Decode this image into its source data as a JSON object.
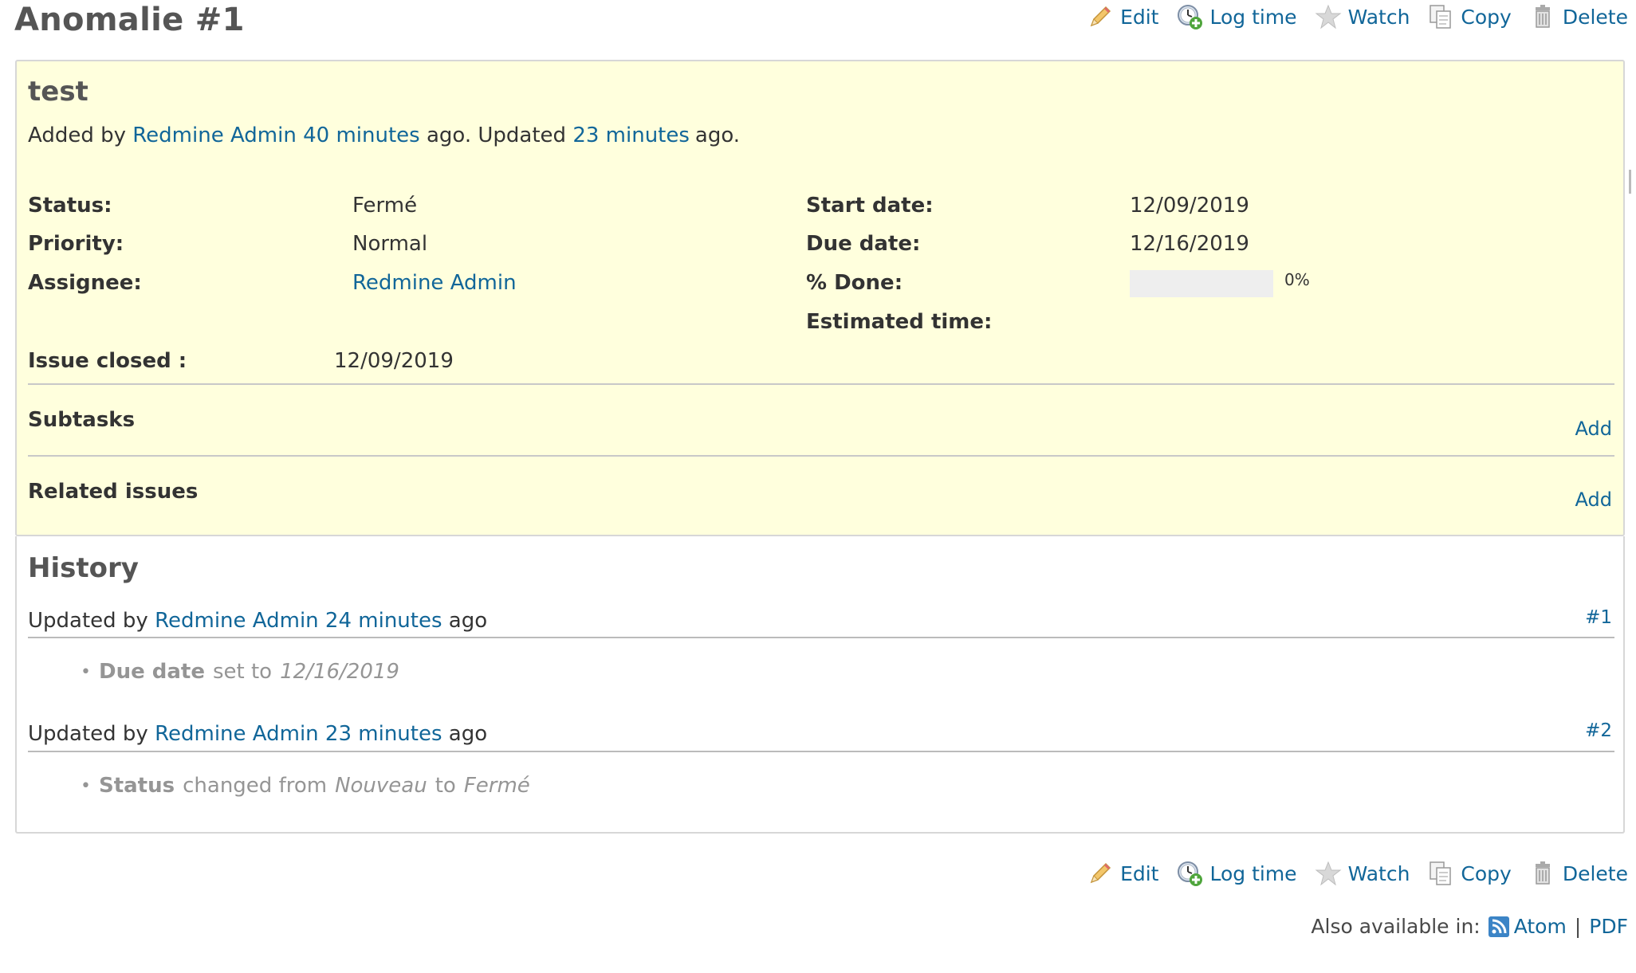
{
  "header": {
    "title": "Anomalie #1",
    "actions": {
      "edit": "Edit",
      "log_time": "Log time",
      "watch": "Watch",
      "copy": "Copy",
      "delete": "Delete"
    }
  },
  "issue": {
    "subject": "test",
    "author_prefix": "Added by",
    "author": "Redmine Admin",
    "created_ago": "40 minutes",
    "ago_updated": "ago. Updated",
    "updated_ago": "23 minutes",
    "ago_end": "ago.",
    "attributes": {
      "status_label": "Status:",
      "status_value": "Fermé",
      "priority_label": "Priority:",
      "priority_value": "Normal",
      "assignee_label": "Assignee:",
      "assignee_value": "Redmine Admin",
      "start_date_label": "Start date:",
      "start_date_value": "12/09/2019",
      "due_date_label": "Due date:",
      "due_date_value": "12/16/2019",
      "done_label": "% Done:",
      "done_value": "0%",
      "done_ratio": 0,
      "estimated_label": "Estimated time:",
      "closed_label": "Issue closed :",
      "closed_value": "12/09/2019"
    },
    "subtasks_title": "Subtasks",
    "subtasks_add": "Add",
    "related_title": "Related issues",
    "related_add": "Add"
  },
  "history": {
    "title": "History",
    "journals": [
      {
        "prefix": "Updated by",
        "author": "Redmine Admin",
        "time": "24 minutes",
        "suffix": "ago",
        "number": "#1",
        "detail_field": "Due date",
        "detail_text": "set to",
        "detail_value": "12/16/2019"
      },
      {
        "prefix": "Updated by",
        "author": "Redmine Admin",
        "time": "23 minutes",
        "suffix": "ago",
        "number": "#2",
        "detail_field": "Status",
        "detail_text": "changed from",
        "detail_old": "Nouveau",
        "detail_to": "to",
        "detail_value": "Fermé"
      }
    ]
  },
  "footer": {
    "also_available": "Also available in:",
    "atom": "Atom",
    "separator": "|",
    "pdf": "PDF"
  },
  "icons": {
    "edit": "pencil-icon",
    "log_time": "clock-add-icon",
    "watch": "star-icon",
    "copy": "copy-icon",
    "delete": "trash-icon",
    "atom": "rss-feed-icon"
  },
  "colors": {
    "link": "#116699",
    "issue_background": "#ffffdd",
    "progress_empty": "#eeeeee"
  }
}
